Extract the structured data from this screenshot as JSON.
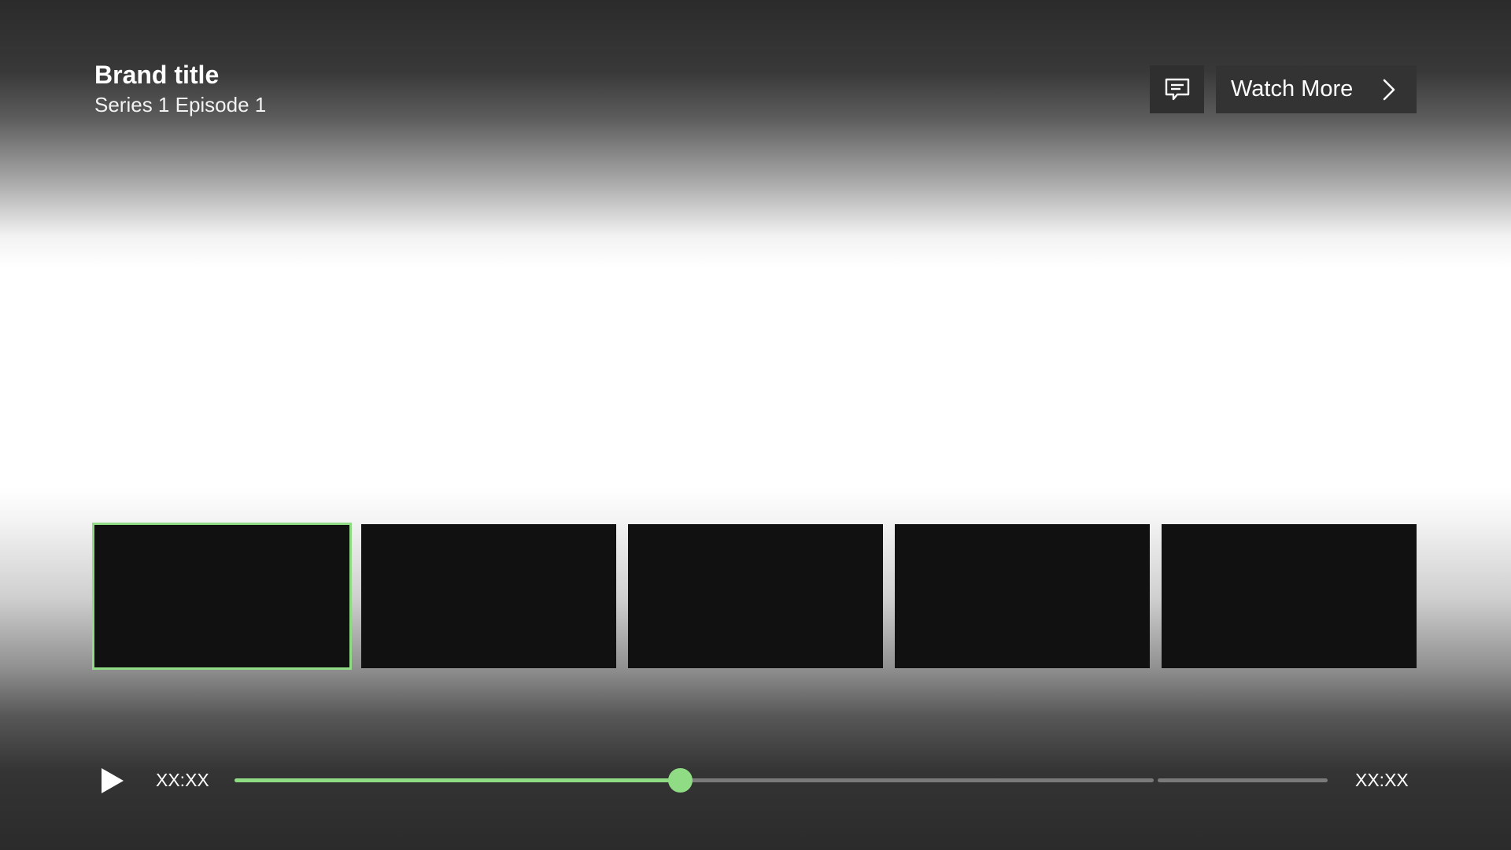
{
  "header": {
    "brand_title": "Brand title",
    "episode_title": "Series 1 Episode 1"
  },
  "controls": {
    "subtitles_icon": "subtitles-icon",
    "watch_more_label": "Watch More",
    "watch_more_icon": "chevron-right-icon"
  },
  "thumbnails": [
    {
      "selected": true
    },
    {
      "selected": false
    },
    {
      "selected": false
    },
    {
      "selected": false
    },
    {
      "selected": false
    }
  ],
  "playback": {
    "play_icon": "play-icon",
    "current_time": "XX:XX",
    "total_time": "XX:XX",
    "progress_fraction": 0.485
  },
  "colors": {
    "accent": "#8fdc84",
    "thumbnail": "#111111",
    "button_bg": "#333333"
  }
}
